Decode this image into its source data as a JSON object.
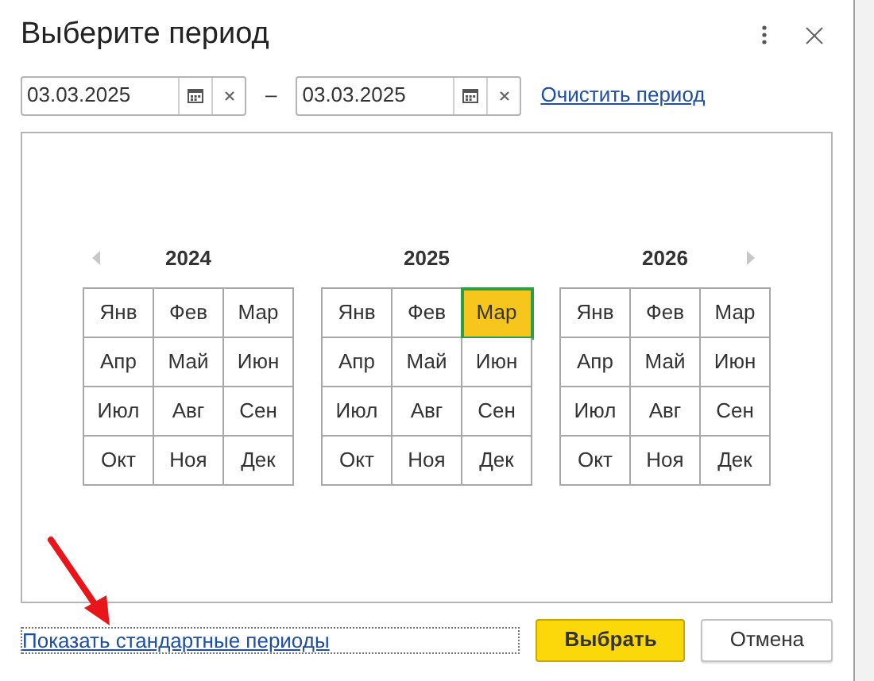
{
  "window": {
    "title": "Выберите период"
  },
  "period": {
    "from": {
      "value": "03.03.2025"
    },
    "separator": "–",
    "to": {
      "value": "03.03.2025"
    },
    "clear_link": "Очистить период"
  },
  "years": [
    {
      "label": "2024",
      "kind": "first",
      "months": [
        {
          "label": "Янв",
          "selected": false
        },
        {
          "label": "Фев",
          "selected": false
        },
        {
          "label": "Мар",
          "selected": false
        },
        {
          "label": "Апр",
          "selected": false
        },
        {
          "label": "Май",
          "selected": false
        },
        {
          "label": "Июн",
          "selected": false
        },
        {
          "label": "Июл",
          "selected": false
        },
        {
          "label": "Авг",
          "selected": false
        },
        {
          "label": "Сен",
          "selected": false
        },
        {
          "label": "Окт",
          "selected": false
        },
        {
          "label": "Ноя",
          "selected": false
        },
        {
          "label": "Дек",
          "selected": false
        }
      ]
    },
    {
      "label": "2025",
      "kind": "middle",
      "months": [
        {
          "label": "Янв",
          "selected": false
        },
        {
          "label": "Фев",
          "selected": false
        },
        {
          "label": "Мар",
          "selected": true
        },
        {
          "label": "Апр",
          "selected": false
        },
        {
          "label": "Май",
          "selected": false
        },
        {
          "label": "Июн",
          "selected": false
        },
        {
          "label": "Июл",
          "selected": false
        },
        {
          "label": "Авг",
          "selected": false
        },
        {
          "label": "Сен",
          "selected": false
        },
        {
          "label": "Окт",
          "selected": false
        },
        {
          "label": "Ноя",
          "selected": false
        },
        {
          "label": "Дек",
          "selected": false
        }
      ]
    },
    {
      "label": "2026",
      "kind": "last",
      "months": [
        {
          "label": "Янв",
          "selected": false
        },
        {
          "label": "Фев",
          "selected": false
        },
        {
          "label": "Мар",
          "selected": false
        },
        {
          "label": "Апр",
          "selected": false
        },
        {
          "label": "Май",
          "selected": false
        },
        {
          "label": "Июн",
          "selected": false
        },
        {
          "label": "Июл",
          "selected": false
        },
        {
          "label": "Авг",
          "selected": false
        },
        {
          "label": "Сен",
          "selected": false
        },
        {
          "label": "Окт",
          "selected": false
        },
        {
          "label": "Ноя",
          "selected": false
        },
        {
          "label": "Дек",
          "selected": false
        }
      ]
    }
  ],
  "footer": {
    "standard_periods_link": "Показать стандартные периоды",
    "buttons": [
      {
        "label": "Выбрать",
        "kind": "primary"
      },
      {
        "label": "Отмена",
        "kind": "secondary"
      }
    ]
  }
}
